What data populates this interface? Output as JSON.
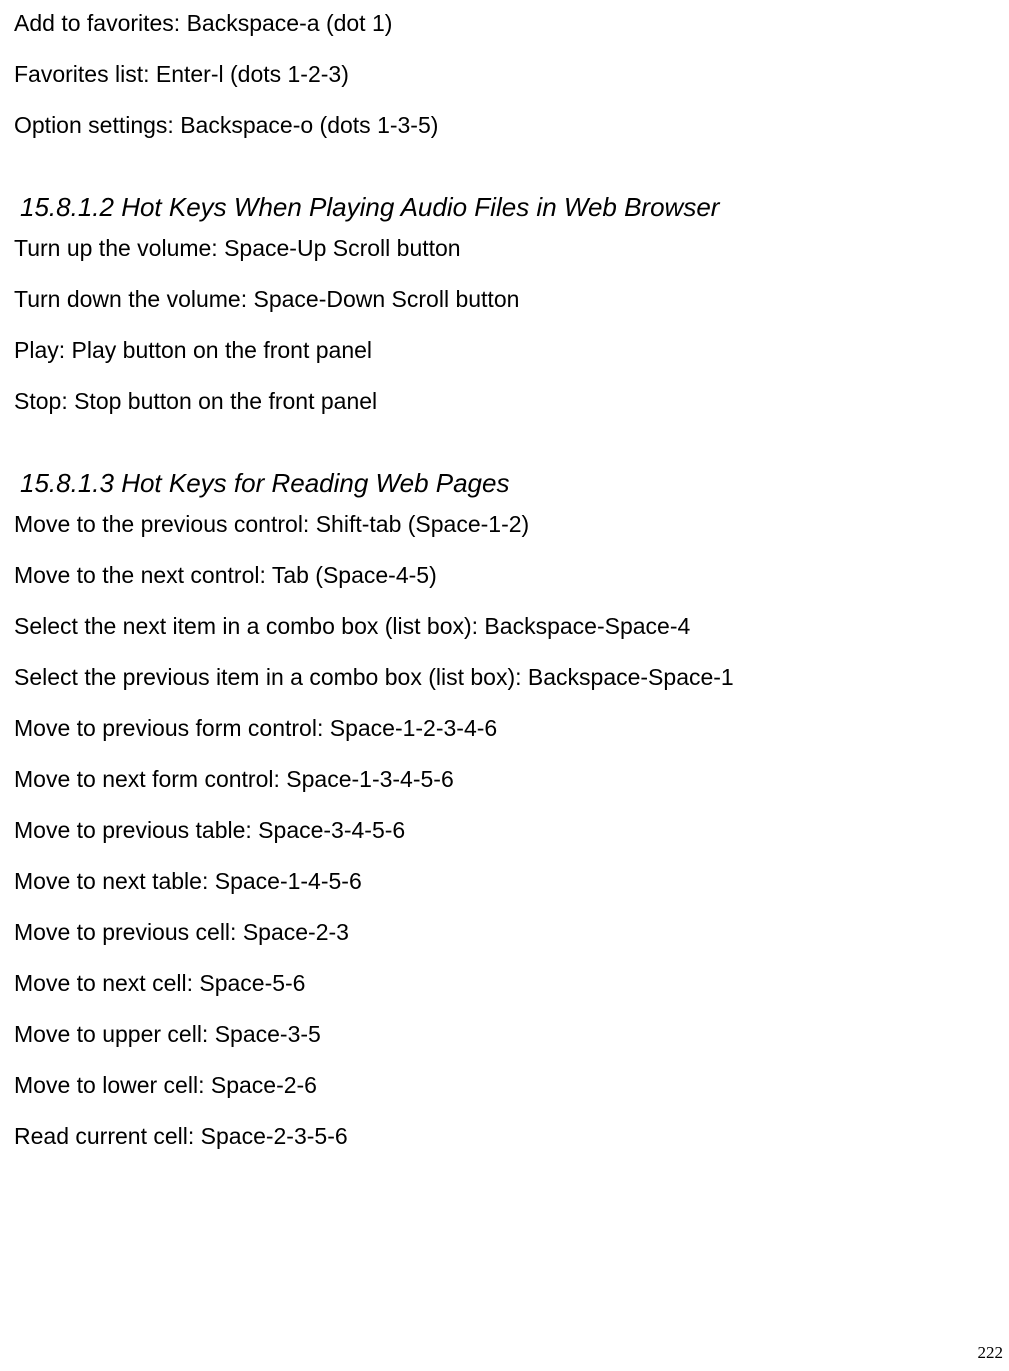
{
  "intro_lines": [
    "Add to favorites: Backspace-a (dot 1)",
    "Favorites list: Enter-l (dots 1-2-3)",
    "Option settings: Backspace-o (dots 1-3-5)"
  ],
  "section_audio": {
    "heading": "15.8.1.2 Hot Keys When Playing Audio Files in Web Browser",
    "lines": [
      "Turn up the volume: Space-Up Scroll button",
      "Turn down the volume: Space-Down Scroll button",
      "Play: Play button on the front panel",
      "Stop: Stop button on the front panel"
    ]
  },
  "section_reading": {
    "heading": "15.8.1.3 Hot Keys for Reading Web Pages",
    "lines": [
      "Move to the previous control: Shift-tab (Space-1-2)",
      "Move to the next control: Tab (Space-4-5)",
      "Select the next item in a combo box (list box): Backspace-Space-4",
      "Select the previous item in a combo box (list box): Backspace-Space-1",
      "Move to previous form control: Space-1-2-3-4-6",
      "Move to next form control: Space-1-3-4-5-6",
      "Move to previous table: Space-3-4-5-6",
      "Move to next table: Space-1-4-5-6",
      "Move to previous cell: Space-2-3",
      "Move to next cell: Space-5-6",
      "Move to upper cell: Space-3-5",
      "Move to lower cell: Space-2-6",
      "Read current cell: Space-2-3-5-6"
    ]
  },
  "page_number": "222"
}
